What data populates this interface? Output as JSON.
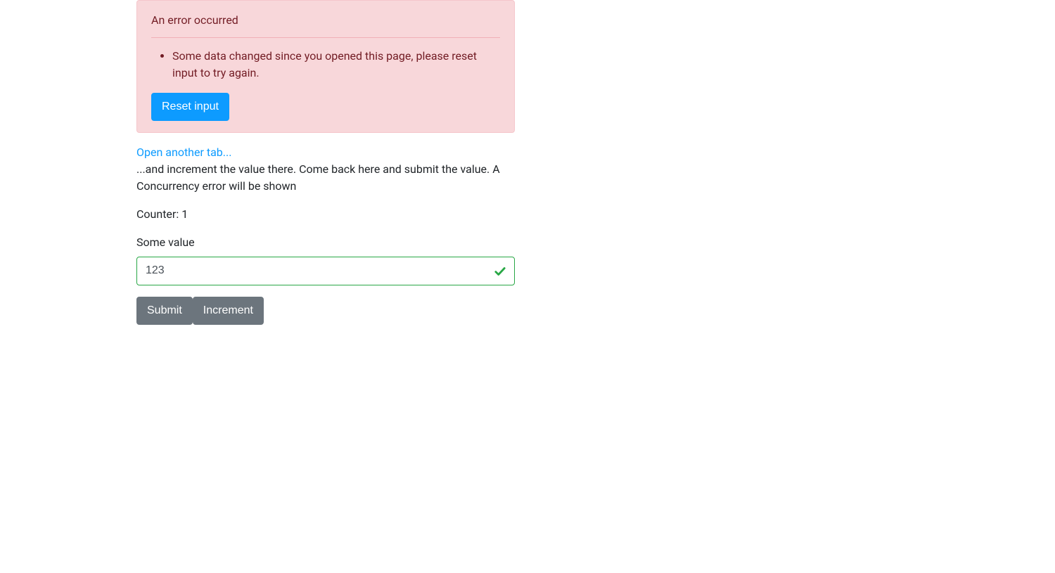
{
  "alert": {
    "title": "An error occurred",
    "items": [
      "Some data changed since you opened this page, please reset input to try again."
    ],
    "reset_button_label": "Reset input"
  },
  "link": {
    "label": "Open another tab..."
  },
  "instructions": "...and increment the value there. Come back here and submit the value. A Concurrency error will be shown",
  "counter": {
    "label": "Counter: ",
    "value": "1"
  },
  "form": {
    "some_value_label": "Some value",
    "some_value_input": "123"
  },
  "buttons": {
    "submit_label": "Submit",
    "increment_label": "Increment"
  }
}
